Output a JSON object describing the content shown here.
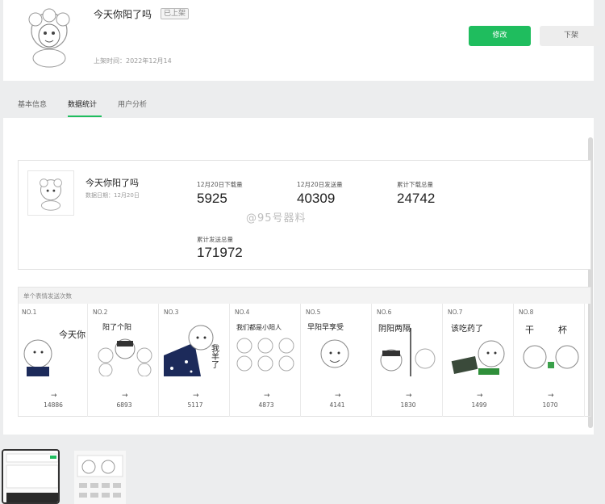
{
  "header": {
    "title": "今天你阳了吗",
    "status": "已上架",
    "list_time": "上架时间：2022年12月14",
    "primary_button": "修改",
    "secondary_button": "下架"
  },
  "tabs": [
    {
      "label": "基本信息"
    },
    {
      "label": "数据统计"
    },
    {
      "label": "用户分析"
    }
  ],
  "summary": {
    "name": "今天你阳了吗",
    "date": "数据日期：12月20日",
    "stats": [
      {
        "label": "12月20日下载量",
        "value": "5925"
      },
      {
        "label": "12月20日发送量",
        "value": "40309"
      },
      {
        "label": "累计下载总量",
        "value": "24742"
      },
      {
        "label": "累计发送总量",
        "value": "171972"
      }
    ],
    "watermark": "@95号器料"
  },
  "stickers": {
    "section_title": "单个表情发送次数",
    "items": [
      {
        "no": "NO.1",
        "text": "今天你阳了吗？",
        "count": "14886",
        "arrow": "→"
      },
      {
        "no": "NO.2",
        "text": "阳了个阳",
        "count": "6893",
        "arrow": "→"
      },
      {
        "no": "NO.3",
        "text": "我羊了",
        "count": "5117",
        "arrow": "→"
      },
      {
        "no": "NO.4",
        "text": "我们都是小阳人",
        "count": "4873",
        "arrow": "→"
      },
      {
        "no": "NO.5",
        "text": "早阳早享受",
        "count": "4141",
        "arrow": "→"
      },
      {
        "no": "NO.6",
        "text": "阴阳两隔",
        "count": "1830",
        "arrow": "→"
      },
      {
        "no": "NO.7",
        "text": "该吃药了",
        "count": "1499",
        "arrow": "→"
      },
      {
        "no": "NO.8",
        "text": "干杯",
        "count": "1070",
        "arrow": "→"
      }
    ]
  },
  "colors": {
    "accent": "#1fbd5e",
    "background": "#ecedee"
  }
}
